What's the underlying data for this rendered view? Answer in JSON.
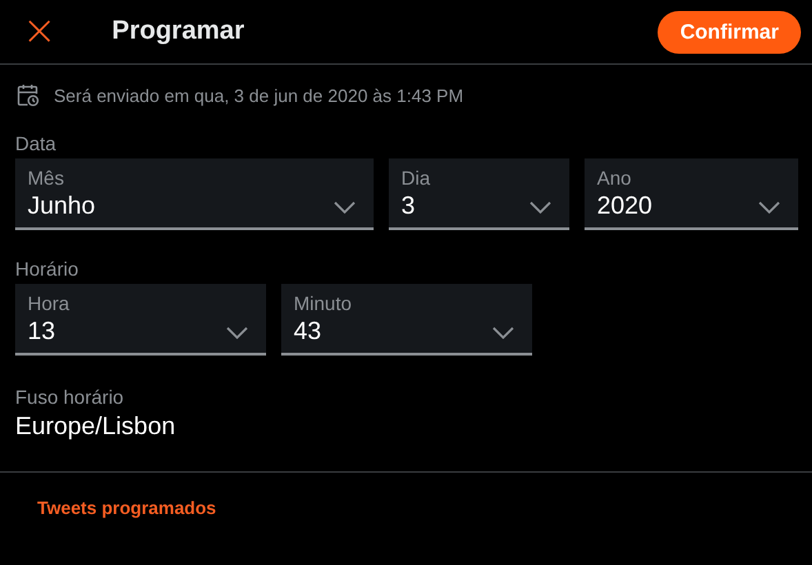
{
  "header": {
    "close": "×",
    "title": "Programar",
    "confirm": "Confirmar"
  },
  "notice": "Será enviado em qua, 3 de jun de 2020 às 1:43 PM",
  "date": {
    "label": "Data",
    "selects": [
      {
        "label": "Mês",
        "value": "Junho"
      },
      {
        "label": "Dia",
        "value": "3"
      },
      {
        "label": "Ano",
        "value": "2020"
      }
    ]
  },
  "time": {
    "label": "Horário",
    "selects": [
      {
        "label": "Hora",
        "value": "13"
      },
      {
        "label": "Minuto",
        "value": "43"
      }
    ]
  },
  "timezone": {
    "label": "Fuso horário",
    "value": "Europe/Lisbon"
  },
  "footer_link": "Tweets programados"
}
